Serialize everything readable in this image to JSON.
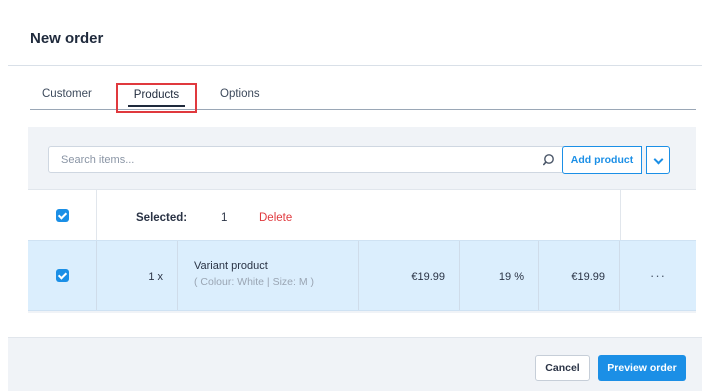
{
  "modal": {
    "title": "New order"
  },
  "tabs": [
    {
      "label": "Customer"
    },
    {
      "label": "Products",
      "active": true
    },
    {
      "label": "Options"
    }
  ],
  "toolbar": {
    "search_placeholder": "Search items...",
    "search_icon": "search-icon",
    "add_product_label": "Add product",
    "add_product_toggle_icon": "chevron-down-icon"
  },
  "selection": {
    "checked": true,
    "label": "Selected:",
    "count": "1",
    "delete_label": "Delete"
  },
  "products": [
    {
      "checked": true,
      "quantity": "1 x",
      "name": "Variant product",
      "variant": "( Colour: White | Size: M )",
      "unit_price": "€19.99",
      "tax": "19 %",
      "total": "€19.99",
      "more_icon": "more-horizontal-icon",
      "more_label": "···"
    }
  ],
  "footer": {
    "cancel_label": "Cancel",
    "preview_label": "Preview order"
  },
  "colors": {
    "accent": "#1b8fe6",
    "danger": "#e0393e",
    "selected_row": "#dbeefd",
    "panel_bg": "#f0f3f7"
  }
}
